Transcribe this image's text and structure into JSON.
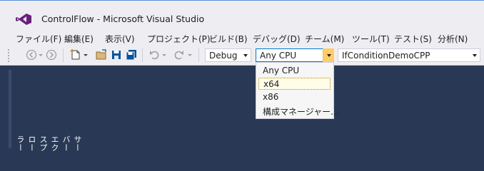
{
  "window": {
    "title": "ControlFlow - Microsoft Visual Studio",
    "accent": "#68217a"
  },
  "menu": [
    {
      "label": "ファイル(F)"
    },
    {
      "label": "編集(E)"
    },
    {
      "label": "表示(V)"
    },
    {
      "label": "プロジェクト(P)"
    },
    {
      "label": "ビルド(B)"
    },
    {
      "label": "デバッグ(D)"
    },
    {
      "label": "チーム(M)"
    },
    {
      "label": "ツール(T)"
    },
    {
      "label": "テスト(S)"
    },
    {
      "label": "分析(N)"
    }
  ],
  "toolbar": {
    "configuration": "Debug",
    "platform": "Any CPU",
    "startup_project": "IfConditionDemoCPP"
  },
  "platform_dropdown": {
    "options": [
      "Any CPU",
      "x64",
      "x86",
      "構成マネージャー..."
    ],
    "highlighted": "x64"
  },
  "sidebar": {
    "label": "サーバー エクスプローラー"
  }
}
